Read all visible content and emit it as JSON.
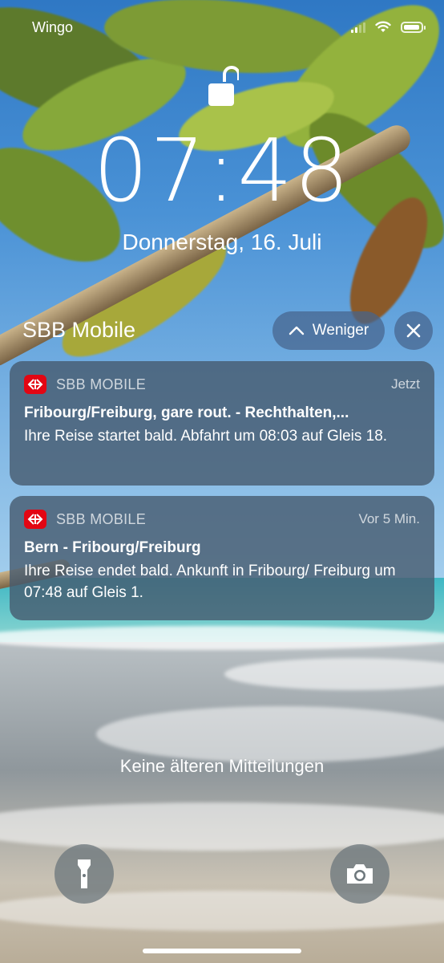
{
  "status_bar": {
    "carrier": "Wingo",
    "signal_bars_active": 2,
    "wifi": "wifi-icon",
    "battery_level": 0.95
  },
  "lock_screen": {
    "lock_state": "unlocked",
    "time": "07:48",
    "date": "Donnerstag, 16. Juli"
  },
  "notification_group": {
    "app_title": "SBB Mobile",
    "collapse_label": "Weniger",
    "clear_icon": "close-icon"
  },
  "notifications": [
    {
      "app": "SBB MOBILE",
      "time": "Jetzt",
      "title": "Fribourg/Freiburg, gare rout. - Rechthalten,...",
      "body": "Ihre Reise startet bald. Abfahrt um 08:03 auf Gleis 18."
    },
    {
      "app": "SBB MOBILE",
      "time": "Vor 5 Min.",
      "title": "Bern - Fribourg/Freiburg",
      "body": "Ihre Reise endet bald. Ankunft in Fribourg/ Freiburg um 07:48 auf Gleis 1."
    }
  ],
  "footer": {
    "no_older_label": "Keine älteren Mitteilungen"
  },
  "quick_actions": {
    "left": "flashlight-icon",
    "right": "camera-icon"
  },
  "colors": {
    "sbb_red": "#e30613",
    "card_bg": "#465a6e",
    "pill_bg": "#46648c"
  }
}
